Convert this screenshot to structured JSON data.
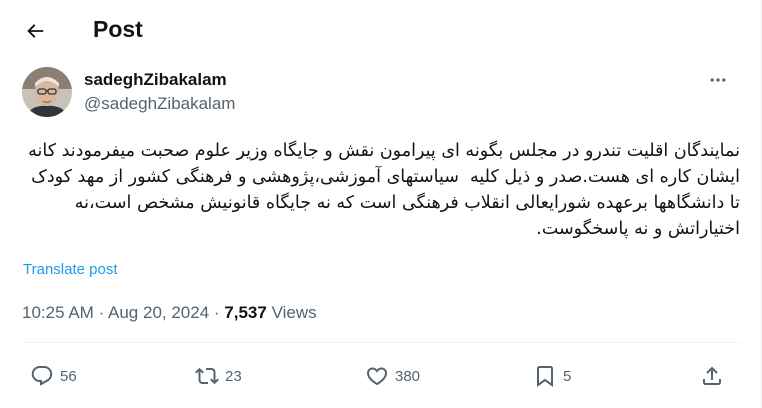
{
  "header": {
    "title": "Post",
    "back_icon": "arrow-left-icon"
  },
  "author": {
    "display_name": "sadeghZibakalam",
    "handle": "@sadeghZibakalam",
    "more_icon": "more-horizontal-icon"
  },
  "tweet": {
    "text": "نمایندگان اقلیت تندرو در مجلس بگونه ای پیرامون نقش و جایگاه وزیر علوم صحبت میفرمودند کانه ایشان کاره ای هست.صدر و ذیل کلیه  سیاستهای آموزشی،پژوهشی و فرهنگی کشور از مهد کودک تا دانشگاهها برعهده شورایعالی انقلاب فرهنگی است که نه جایگاه قانونیش مشخص است،نه اختیاراتش و نه پاسخگوست.",
    "translate_label": "Translate post"
  },
  "meta": {
    "time": "10:25 AM",
    "date": "Aug 20, 2024",
    "views_count": "7,537",
    "views_label": "Views"
  },
  "actions": {
    "replies": "56",
    "reposts": "23",
    "likes": "380",
    "bookmarks": "5",
    "share_icon": "share-icon"
  },
  "colors": {
    "text": "#0f1419",
    "secondary": "#536471",
    "link": "#1d9bf0",
    "border": "#eff3f4"
  }
}
